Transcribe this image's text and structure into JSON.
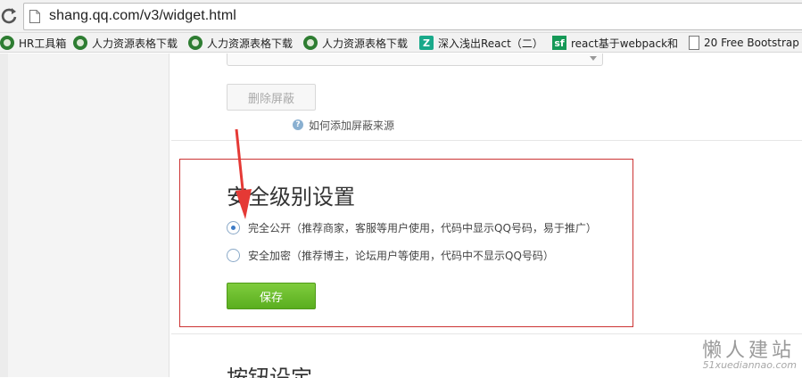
{
  "browser": {
    "url": "shang.qq.com/v3/widget.html",
    "bookmarks": [
      {
        "label": "HR工具箱",
        "icon": "leaf-icon"
      },
      {
        "label": "人力资源表格下载",
        "icon": "leaf-icon"
      },
      {
        "label": "人力资源表格下载",
        "icon": "leaf-icon"
      },
      {
        "label": "人力资源表格下载",
        "icon": "leaf-icon"
      },
      {
        "label": "深入浅出React（二）",
        "icon": "site-z-icon"
      },
      {
        "label": "react基于webpack和",
        "icon": "sf-icon"
      },
      {
        "label": "20 Free Bootstrap",
        "icon": "document-icon"
      }
    ]
  },
  "page": {
    "remove_button": "删除屏蔽",
    "help_link": "如何添加屏蔽来源",
    "security": {
      "title": "安全级别设置",
      "options": [
        {
          "label": "完全公开（推荐商家，客服等用户使用，代码中显示QQ号码，易于推广）",
          "checked": true
        },
        {
          "label": "安全加密（推荐博主，论坛用户等使用，代码中不显示QQ号码）",
          "checked": false
        }
      ],
      "save_button": "保存"
    },
    "next_section_title": "按钮设定"
  },
  "watermark": {
    "title": "懒人建站",
    "subtitle": "51xuediannao.com"
  },
  "colors": {
    "highlight_border": "#cc3333",
    "save_button": "#66b82a",
    "arrow": "#e53935"
  }
}
